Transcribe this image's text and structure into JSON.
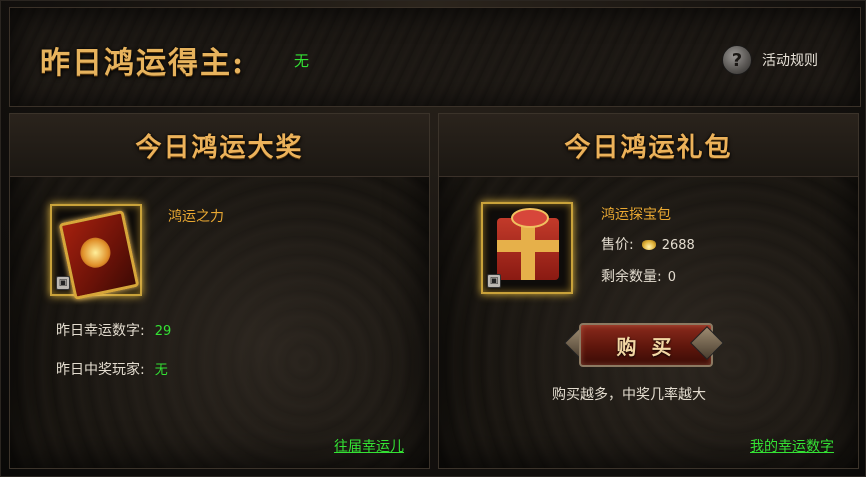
{
  "header": {
    "title": "昨日鸿运得主:",
    "winner": "无",
    "rules_label": "活动规则",
    "rules_icon": "question-mark-icon"
  },
  "left_panel": {
    "title": "今日鸿运大奖",
    "item_name": "鸿运之力",
    "item_icon": "fortune-card-icon",
    "lucky_number_label": "昨日幸运数字:",
    "lucky_number_value": "29",
    "winner_label": "昨日中奖玩家:",
    "winner_value": "无",
    "link": "往届幸运儿"
  },
  "right_panel": {
    "title": "今日鸿运礼包",
    "item_name": "鸿运探宝包",
    "item_icon": "gift-box-icon",
    "price_label": "售价:",
    "price_currency_icon": "gold-ingot-icon",
    "price_value": "2688",
    "remaining_label": "剩余数量:",
    "remaining_value": "0",
    "buy_label": "购 买",
    "hint": "购买越多，中奖几率越大",
    "link": "我的幸运数字"
  },
  "colors": {
    "title_gold": "#e7b35d",
    "highlight_green": "#34e234",
    "item_name_orange": "#e9a832"
  }
}
